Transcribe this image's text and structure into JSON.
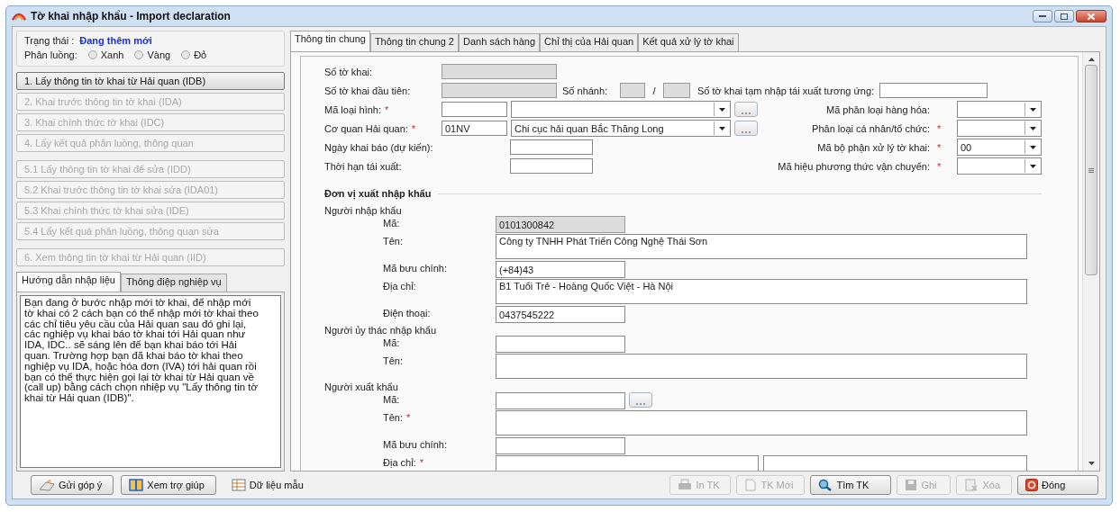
{
  "window": {
    "title": "Tờ khai nhập khẩu - Import declaration"
  },
  "required_mark": "*",
  "status": {
    "label": "Trạng thái :",
    "value": "Đang thêm mới"
  },
  "lane": {
    "label": "Phân luồng:",
    "options": [
      {
        "label": "Xanh",
        "selected": false
      },
      {
        "label": "Vàng",
        "selected": false
      },
      {
        "label": "Đỏ",
        "selected": false
      }
    ]
  },
  "step_groups": [
    [
      {
        "label": "1. Lấy thông tin tờ khai từ Hải quan (IDB)",
        "disabled": false
      },
      {
        "label": "2. Khai trước thông tin tờ khai (IDA)",
        "disabled": true
      },
      {
        "label": "3. Khai chính thức tờ khai (IDC)",
        "disabled": true
      },
      {
        "label": "4. Lấy kết quả phân luồng, thông quan",
        "disabled": true
      }
    ],
    [
      {
        "label": "5.1 Lấy thông tin tờ khai để sửa (IDD)",
        "disabled": true
      },
      {
        "label": "5.2 Khai trước thông tin tờ khai sửa (IDA01)",
        "disabled": true
      },
      {
        "label": "5.3 Khai chính thức tờ khai sửa (IDE)",
        "disabled": true
      },
      {
        "label": "5.4 Lấy kết quả phân luồng, thông quan sửa",
        "disabled": true
      }
    ],
    [
      {
        "label": "6. Xem thông tin tờ khai từ Hải quan (IID)",
        "disabled": true
      }
    ]
  ],
  "help_tabs": [
    {
      "label": "Hướng dẫn nhập liệu",
      "selected": true
    },
    {
      "label": "Thông điệp nghiệp vụ",
      "selected": false
    }
  ],
  "help_text": "Bạn đang ở bước nhập mới tờ khai, để nhập mới tờ khai có 2 cách bạn có thể nhập mới tờ khai theo các chỉ tiêu yêu cầu của Hải quan sau đó ghi lại, các nghiệp vụ khai báo tờ khai tới Hải quan như IDA, IDC.. sẽ sáng lên để bạn khai báo tới Hải quan. Trường hợp bạn đã khai báo tờ khai theo nghiệp vụ IDA, hoặc hóa đơn (IVA) tới hải quan rồi bạn có thể thực hiện gọi lại tờ khai từ Hải quan về (call up) bằng cách chọn nhiệp vụ \"Lấy thông tin tờ khai từ Hải quan (IDB)\".",
  "tabs": [
    {
      "label": "Thông tin chung",
      "selected": true
    },
    {
      "label": "Thông tin chung 2",
      "selected": false
    },
    {
      "label": "Danh sách hàng",
      "selected": false
    },
    {
      "label": "Chỉ thị của Hải quan",
      "selected": false
    },
    {
      "label": "Kết quả xử lý tờ khai",
      "selected": false
    }
  ],
  "header": {
    "declaration_no": {
      "label": "Số tờ khai:",
      "readonly": true
    },
    "first_declaration_no": {
      "label": "Số tờ khai đầu tiên:",
      "readonly": true
    },
    "branch_no": {
      "label": "Số nhánh:",
      "separator": "/"
    },
    "temp_import_no": {
      "label": "Số tờ khai tạm nhập tái xuất tương ứng:"
    },
    "type_code": {
      "label": "Mã loại hình:",
      "required": true
    },
    "goods_class": {
      "label": "Mã phân loại hàng hóa:",
      "required": false
    },
    "customs_office": {
      "label": "Cơ quan Hải quan:",
      "required": true,
      "code": "01NV",
      "name": "Chi cục hải quan Bắc Thăng Long"
    },
    "person_org": {
      "label": "Phân loại cá nhân/tổ chức:",
      "required": true
    },
    "declare_date": {
      "label": "Ngày khai báo (dự kiến):"
    },
    "processing_unit": {
      "label": "Mã bộ phận xử lý tờ khai:",
      "required": true,
      "value": "00"
    },
    "reexport_deadline": {
      "label": "Thời hạn tái xuất:"
    },
    "transport_mode": {
      "label": "Mã hiệu phương thức vận chuyển:",
      "required": true
    }
  },
  "section_title": "Đơn vị xuất nhập khẩu",
  "parties": [
    {
      "title": "Người nhập khẩu",
      "fields": [
        {
          "label": "Mã:",
          "kind": "short",
          "readonly": true,
          "required": false,
          "value": "0101300842"
        },
        {
          "label": "Tên:",
          "kind": "long",
          "readonly": false,
          "required": false,
          "value": "Công ty TNHH Phát Triển Công Nghệ Thái Sơn"
        },
        {
          "label": "Mã bưu chính:",
          "kind": "short",
          "readonly": false,
          "required": false,
          "value": "(+84)43"
        },
        {
          "label": "Địa chỉ:",
          "kind": "long",
          "readonly": false,
          "required": false,
          "value": "B1 Tuổi Trẻ - Hoàng Quốc Việt -  Hà Nội"
        },
        {
          "label": "Điện thoại:",
          "kind": "short",
          "readonly": false,
          "required": false,
          "value": "0437545222"
        }
      ]
    },
    {
      "title": "Người ủy thác nhập khẩu",
      "fields": [
        {
          "label": "Mã:",
          "kind": "short",
          "readonly": false,
          "required": false
        },
        {
          "label": "Tên:",
          "kind": "long",
          "readonly": false,
          "required": false
        }
      ]
    },
    {
      "title": "Người xuất khẩu",
      "fields": [
        {
          "label": "Mã:",
          "kind": "lookup",
          "readonly": false,
          "required": false
        },
        {
          "label": "Tên:",
          "kind": "long",
          "readonly": false,
          "required": true
        },
        {
          "label": "Mã bưu chính:",
          "kind": "short",
          "readonly": false,
          "required": false
        },
        {
          "label": "Địa chỉ:",
          "kind": "split",
          "readonly": false,
          "required": true
        }
      ]
    }
  ],
  "bottom_left": [
    {
      "label": "Gửi góp ý",
      "kind": "feedback"
    },
    {
      "label": "Xem trợ giúp",
      "kind": "help"
    },
    {
      "label": "Dữ liệu mẫu",
      "kind": "sample"
    }
  ],
  "bottom_right": [
    {
      "label": "In TK",
      "kind": "print",
      "disabled": true
    },
    {
      "label": "TK Mới",
      "kind": "new",
      "disabled": true
    },
    {
      "label": "Tìm TK",
      "kind": "search",
      "disabled": false
    },
    {
      "label": "Ghi",
      "kind": "save",
      "disabled": true
    },
    {
      "label": "Xóa",
      "kind": "delete",
      "disabled": true
    },
    {
      "label": "Đóng",
      "kind": "close",
      "disabled": false
    }
  ]
}
